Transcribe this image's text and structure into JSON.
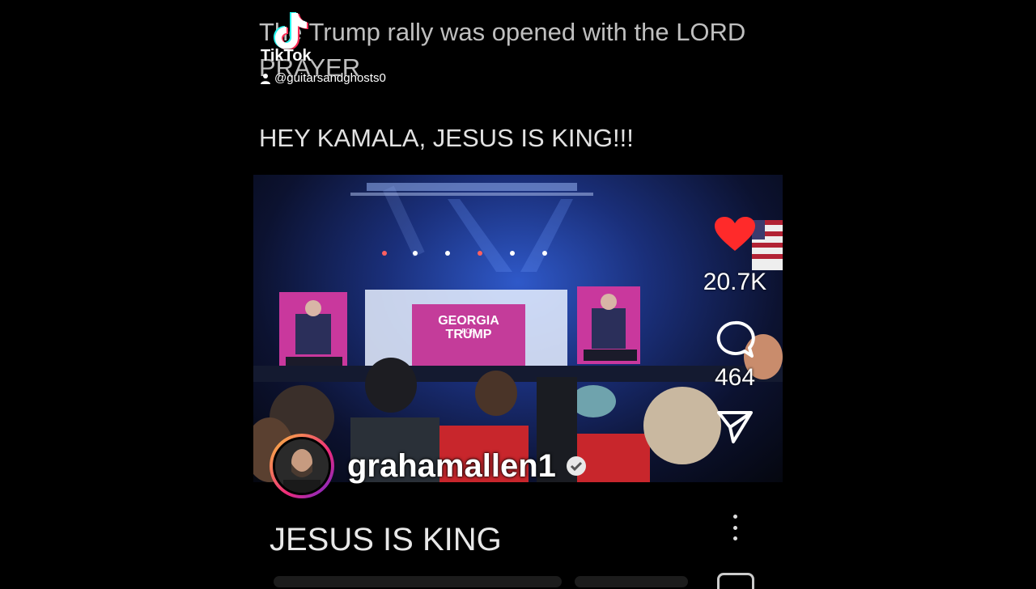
{
  "post": {
    "title": "The Trump rally was opened with the LORD PRAYER",
    "subtitle": "HEY KAMALA, JESUS IS KING!!!"
  },
  "watermark": {
    "brand": "TikTok",
    "username": "@guitarsandghosts0"
  },
  "media": {
    "screen_text_line1": "GEORGIA",
    "screen_text_line2": "FOR",
    "screen_text_line3": "TRUMP"
  },
  "actions": {
    "likes": "20.7K",
    "comments": "464"
  },
  "author": {
    "name": "grahamallen1"
  },
  "caption": "JESUS IS KING",
  "colors": {
    "like": "#ff2a2a",
    "background": "#000000",
    "avatar_ring": "#ee2a7b"
  }
}
